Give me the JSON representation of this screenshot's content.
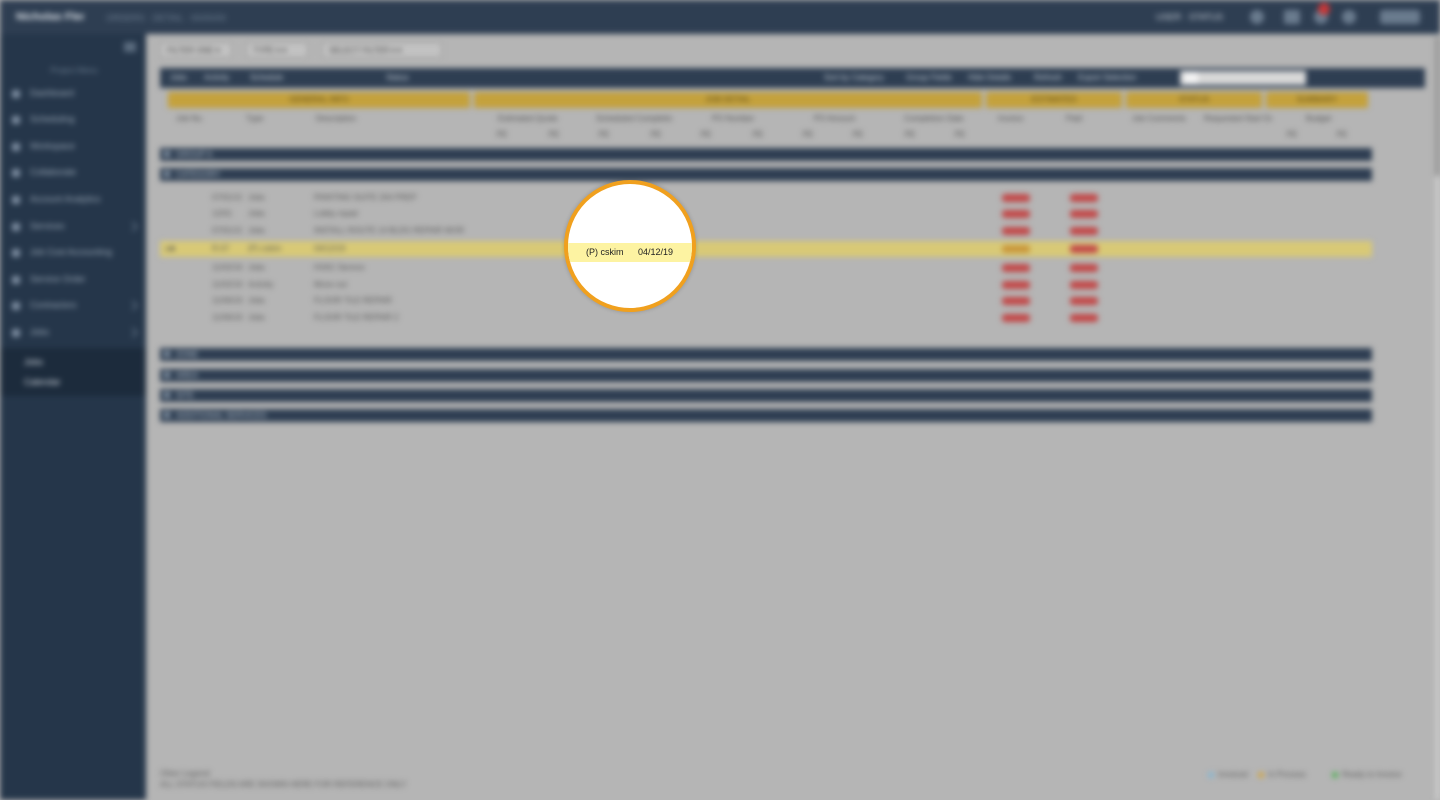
{
  "app": {
    "brand": "Nicholas Fleming",
    "breadcrumb": "ORDERS · DETAIL · 00/00/00"
  },
  "header": {
    "user_label": "USER · STATUS",
    "notification_count": "1"
  },
  "sidebar": {
    "caption": "Project Menu",
    "items": [
      {
        "label": "Dashboard",
        "icon": "home-icon"
      },
      {
        "label": "Scheduling",
        "icon": "calendar-icon"
      },
      {
        "label": "Workspace",
        "icon": "folder-icon"
      },
      {
        "label": "Collaborate",
        "icon": "users-icon"
      },
      {
        "label": "Account Analytics",
        "icon": "chart-icon"
      },
      {
        "label": "Services",
        "icon": "gear-icon"
      },
      {
        "label": "Job Cost Accounting",
        "icon": "calculator-icon"
      },
      {
        "label": "Service Order",
        "icon": "clipboard-icon"
      },
      {
        "label": "Contractors",
        "icon": "truck-icon"
      },
      {
        "label": "Jobs",
        "icon": "briefcase-icon"
      }
    ],
    "sub_items": [
      {
        "label": "Jobs"
      },
      {
        "label": "Calendar"
      }
    ]
  },
  "filters": [
    {
      "label": "FILTER ONE ▾"
    },
    {
      "label": "TYPE ▾ ▾"
    },
    {
      "label": "SELECT FILTER ▾ ▾"
    }
  ],
  "grid": {
    "left_tabs": [
      "Jobs",
      "Activity",
      "Schedule",
      "Status"
    ],
    "right_tabs": [
      "Sort by Category",
      "Group Fields",
      "Hide Details",
      "Refresh",
      "Export Selection"
    ],
    "gold_headers": [
      "GENERAL INFO",
      "JOB DETAIL",
      "ESTIMATED",
      "STATUS",
      "SUMMARY"
    ],
    "col_headers": [
      "Job No.",
      "Type",
      "Description",
      "Estimated Quote",
      "Scheduled Completion",
      "PO Number",
      "PO Amount",
      "Completion Date",
      "Invoice",
      "Paid",
      "Job Comments",
      "Requested Start Date",
      "Budget"
    ],
    "sub_header": "PE",
    "groups": [
      {
        "label": "GROUP A"
      },
      {
        "label": "CATEGORY"
      }
    ],
    "rows": [
      {
        "id": "07/01/19",
        "type": "Jobs",
        "description": "PAINTING SUITE 204 PREP"
      },
      {
        "id": "12/01",
        "type": "Jobs",
        "description": "Lobby repair"
      },
      {
        "id": "07/01/19",
        "type": "Jobs",
        "description": "INSTALL ROUTE 14 BLDG REPAIR WORK"
      },
      {
        "id": "R-07",
        "type": "(P) cskim",
        "description": "04/12/19",
        "highlighted": true
      },
      {
        "id": "11/02/19",
        "type": "Jobs",
        "description": "HVAC Service"
      },
      {
        "id": "11/02/19",
        "type": "Activity",
        "description": "Move out"
      },
      {
        "id": "11/06/19",
        "type": "Jobs",
        "description": "FLOOR TILE REPAIR"
      },
      {
        "id": "11/06/19",
        "type": "Jobs",
        "description": "FLOOR TILE REPAIR 2"
      }
    ],
    "collapsed_groups": [
      {
        "label": "ZONE"
      },
      {
        "label": "AREA"
      },
      {
        "label": "SITE"
      },
      {
        "label": "ADDITIONAL SERVICES"
      }
    ]
  },
  "footer": {
    "note_line1": "Other Legend:",
    "note_line2": "ALL STATUS FIELDS ARE SHOWN HERE FOR REFERENCE ONLY",
    "legend": [
      {
        "label": "Invoiced",
        "color": "#7fb6d6"
      },
      {
        "label": "In Process",
        "color": "#d4a43a"
      },
      {
        "label": "Ready to Invoice",
        "color": "#4caf50"
      }
    ]
  },
  "magnifier": {
    "user": "(P) cskim",
    "date": "04/12/19"
  },
  "colors": {
    "accent": "#f0a01e",
    "header_navy": "#2e3e52",
    "highlight": "#fdf3a2",
    "status_red": "#c24747"
  }
}
